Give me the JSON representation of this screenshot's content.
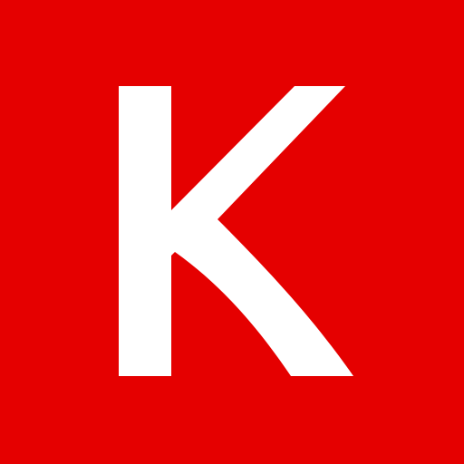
{
  "logo": {
    "letter": "K",
    "background_color": "#e50000",
    "letter_color": "#ffffff"
  }
}
